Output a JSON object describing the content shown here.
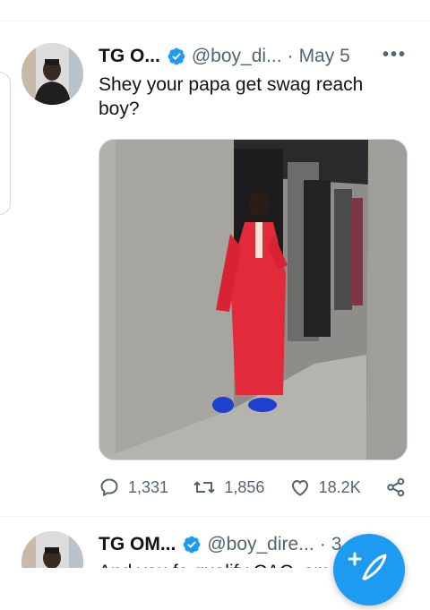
{
  "tweets": [
    {
      "name": "TG O...",
      "handle": "@boy_di...",
      "separator": "·",
      "date": "May 5",
      "text": "Shey your papa get swag reach boy?",
      "stats": {
        "replies": "1,331",
        "retweets": "1,856",
        "likes": "18.2K"
      }
    },
    {
      "name": "TG OM...",
      "handle": "@boy_dire...",
      "separator": "·",
      "date": "3",
      "text": "And you fo qualify CAC, omo i"
    }
  ],
  "more_label": "•••",
  "colors": {
    "accent": "#1d9bf0",
    "muted": "#536471",
    "text": "#0f1419"
  }
}
